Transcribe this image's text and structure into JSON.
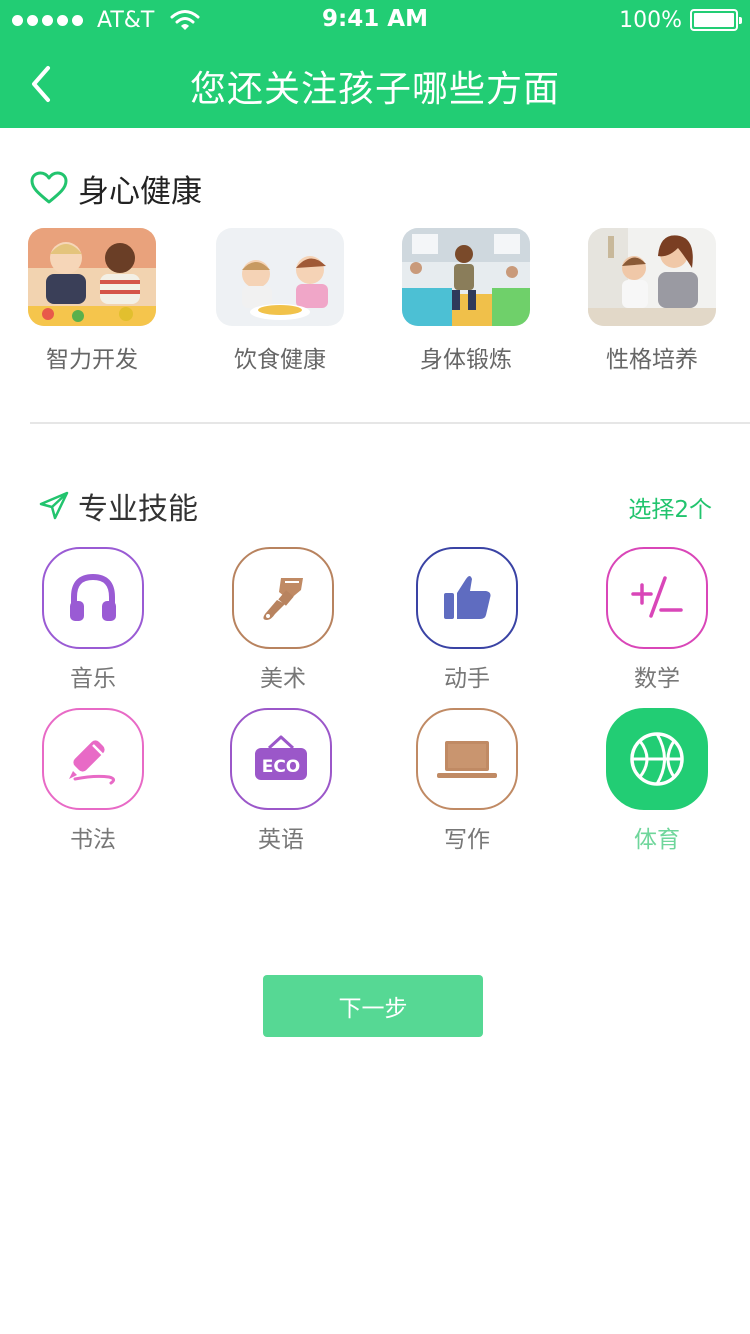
{
  "status_bar": {
    "carrier": "AT&T",
    "time": "9:41 AM",
    "battery": "100%",
    "battery_level": 1.0
  },
  "nav": {
    "title": "您还关注孩子哪些方面",
    "back_icon": "chevron-left-icon"
  },
  "health_section": {
    "title": "身心健康",
    "icon": "heart-outline-icon",
    "items": [
      {
        "label": "智力开发"
      },
      {
        "label": "饮食健康"
      },
      {
        "label": "身体锻炼"
      },
      {
        "label": "性格培养"
      }
    ]
  },
  "skills_section": {
    "title": "专业技能",
    "icon": "navigation-arrow-icon",
    "select_count": "选择2个",
    "items": [
      {
        "label": "音乐",
        "icon": "headphones-icon",
        "color": "#9a5bd4",
        "selected": false
      },
      {
        "label": "美术",
        "icon": "paint-brush-icon",
        "color": "#b8835f",
        "selected": false
      },
      {
        "label": "动手",
        "icon": "thumbs-up-icon",
        "color": "#5f6cc0",
        "selected": false
      },
      {
        "label": "数学",
        "icon": "plus-minus-icon",
        "color": "#d946b8",
        "selected": false
      },
      {
        "label": "书法",
        "icon": "pen-icon",
        "color": "#e86ac6",
        "selected": false
      },
      {
        "label": "英语",
        "icon": "eco-sign-icon",
        "color": "#9b57c9",
        "selected": false
      },
      {
        "label": "写作",
        "icon": "laptop-icon",
        "color": "#c08a64",
        "selected": false
      },
      {
        "label": "体育",
        "icon": "basketball-icon",
        "color": "#22cd74",
        "selected": true
      }
    ]
  },
  "next_button": {
    "label": "下一步"
  },
  "colors": {
    "brand_green": "#22cd74",
    "button_green": "#56d894"
  }
}
